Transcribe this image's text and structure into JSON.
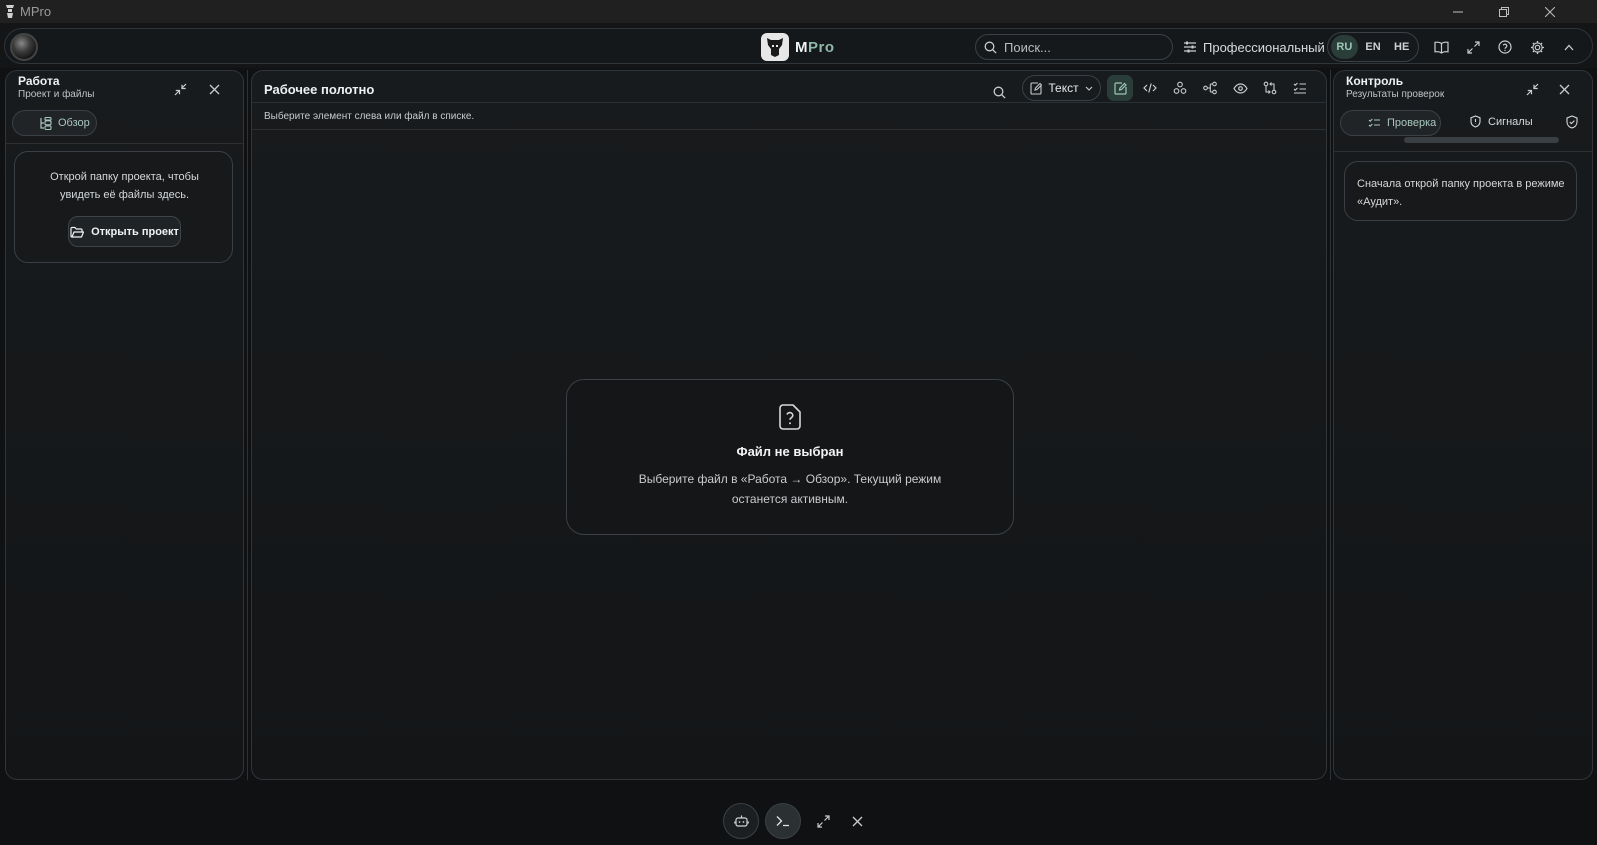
{
  "window": {
    "title": "MPro"
  },
  "brand": {
    "first": "M",
    "rest": "Pro"
  },
  "search": {
    "placeholder": "Поиск..."
  },
  "mode": {
    "label": "Профессиональный"
  },
  "languages": [
    {
      "code": "RU",
      "active": true
    },
    {
      "code": "EN",
      "active": false
    },
    {
      "code": "HE",
      "active": false
    }
  ],
  "left_panel": {
    "title": "Работа",
    "subtitle": "Проект и файлы",
    "tab_label": "Обзор",
    "hint": "Открой папку проекта, чтобы увидеть её файлы здесь.",
    "open_button": "Открыть проект"
  },
  "center_panel": {
    "title": "Рабочее полотно",
    "view_select": "Текст",
    "hint": "Выберите элемент слева или файл в списке.",
    "empty": {
      "title": "Файл не выбран",
      "text": "Выберите файл в «Работа → Обзор». Текущий режим останется активным."
    }
  },
  "right_panel": {
    "title": "Контроль",
    "subtitle": "Результаты проверок",
    "tabs": [
      "Проверка",
      "Сигналы"
    ],
    "message": "Сначала открой папку проекта в режиме «Аудит»."
  },
  "colors": {
    "accent": "#9cc7b8",
    "accent_bg": "#2b3d38",
    "background": "#0f1113",
    "panel_border": "#30353a"
  },
  "icons": {
    "top": [
      "book-icon",
      "expand-icon",
      "help-icon",
      "gear-icon",
      "chevron-up-icon"
    ],
    "toolbar": [
      "search-icon",
      "edit-icon",
      "code-icon",
      "network-icon",
      "flow-icon",
      "eye-icon",
      "diff-icon",
      "checklist-icon"
    ],
    "dock": [
      "robot-icon",
      "terminal-icon",
      "expand-icon",
      "close-icon"
    ]
  }
}
